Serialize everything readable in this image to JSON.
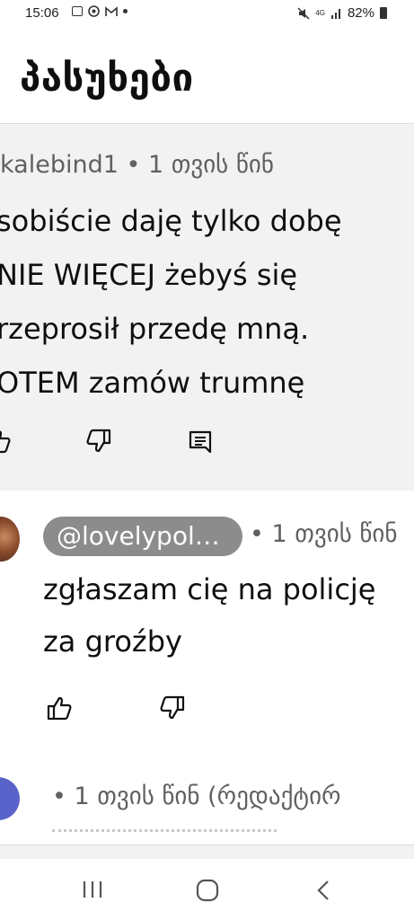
{
  "status_bar": {
    "time": "15:06",
    "battery": "82%",
    "network": "4G"
  },
  "header": {
    "title": "პასუხები"
  },
  "parent_comment": {
    "author": "kalebind1",
    "time": "1 თვის წინ",
    "text": "sobiście daję tylko dobę\nNIE WIĘCEJ żebyś się\nrzeprosił przedę mną.\nOTEM zamów trumnę"
  },
  "replies": [
    {
      "mention": "@lovelypol…",
      "time": "1 თვის წინ",
      "text": "zgłaszam cię na policję\nza groźby"
    },
    {
      "time": "1 თვის წინ (რედაქტირ"
    }
  ],
  "icons": {
    "like": "thumbs-up-icon",
    "dislike": "thumbs-down-icon",
    "reply": "comment-icon",
    "nav_recent": "recent-apps-icon",
    "nav_home": "home-icon",
    "nav_back": "back-icon"
  },
  "colors": {
    "background": "#ffffff",
    "highlight": "#f2f2f2",
    "mention_chip": "#8c8c8c",
    "avatar_blue": "#5a63c9"
  }
}
